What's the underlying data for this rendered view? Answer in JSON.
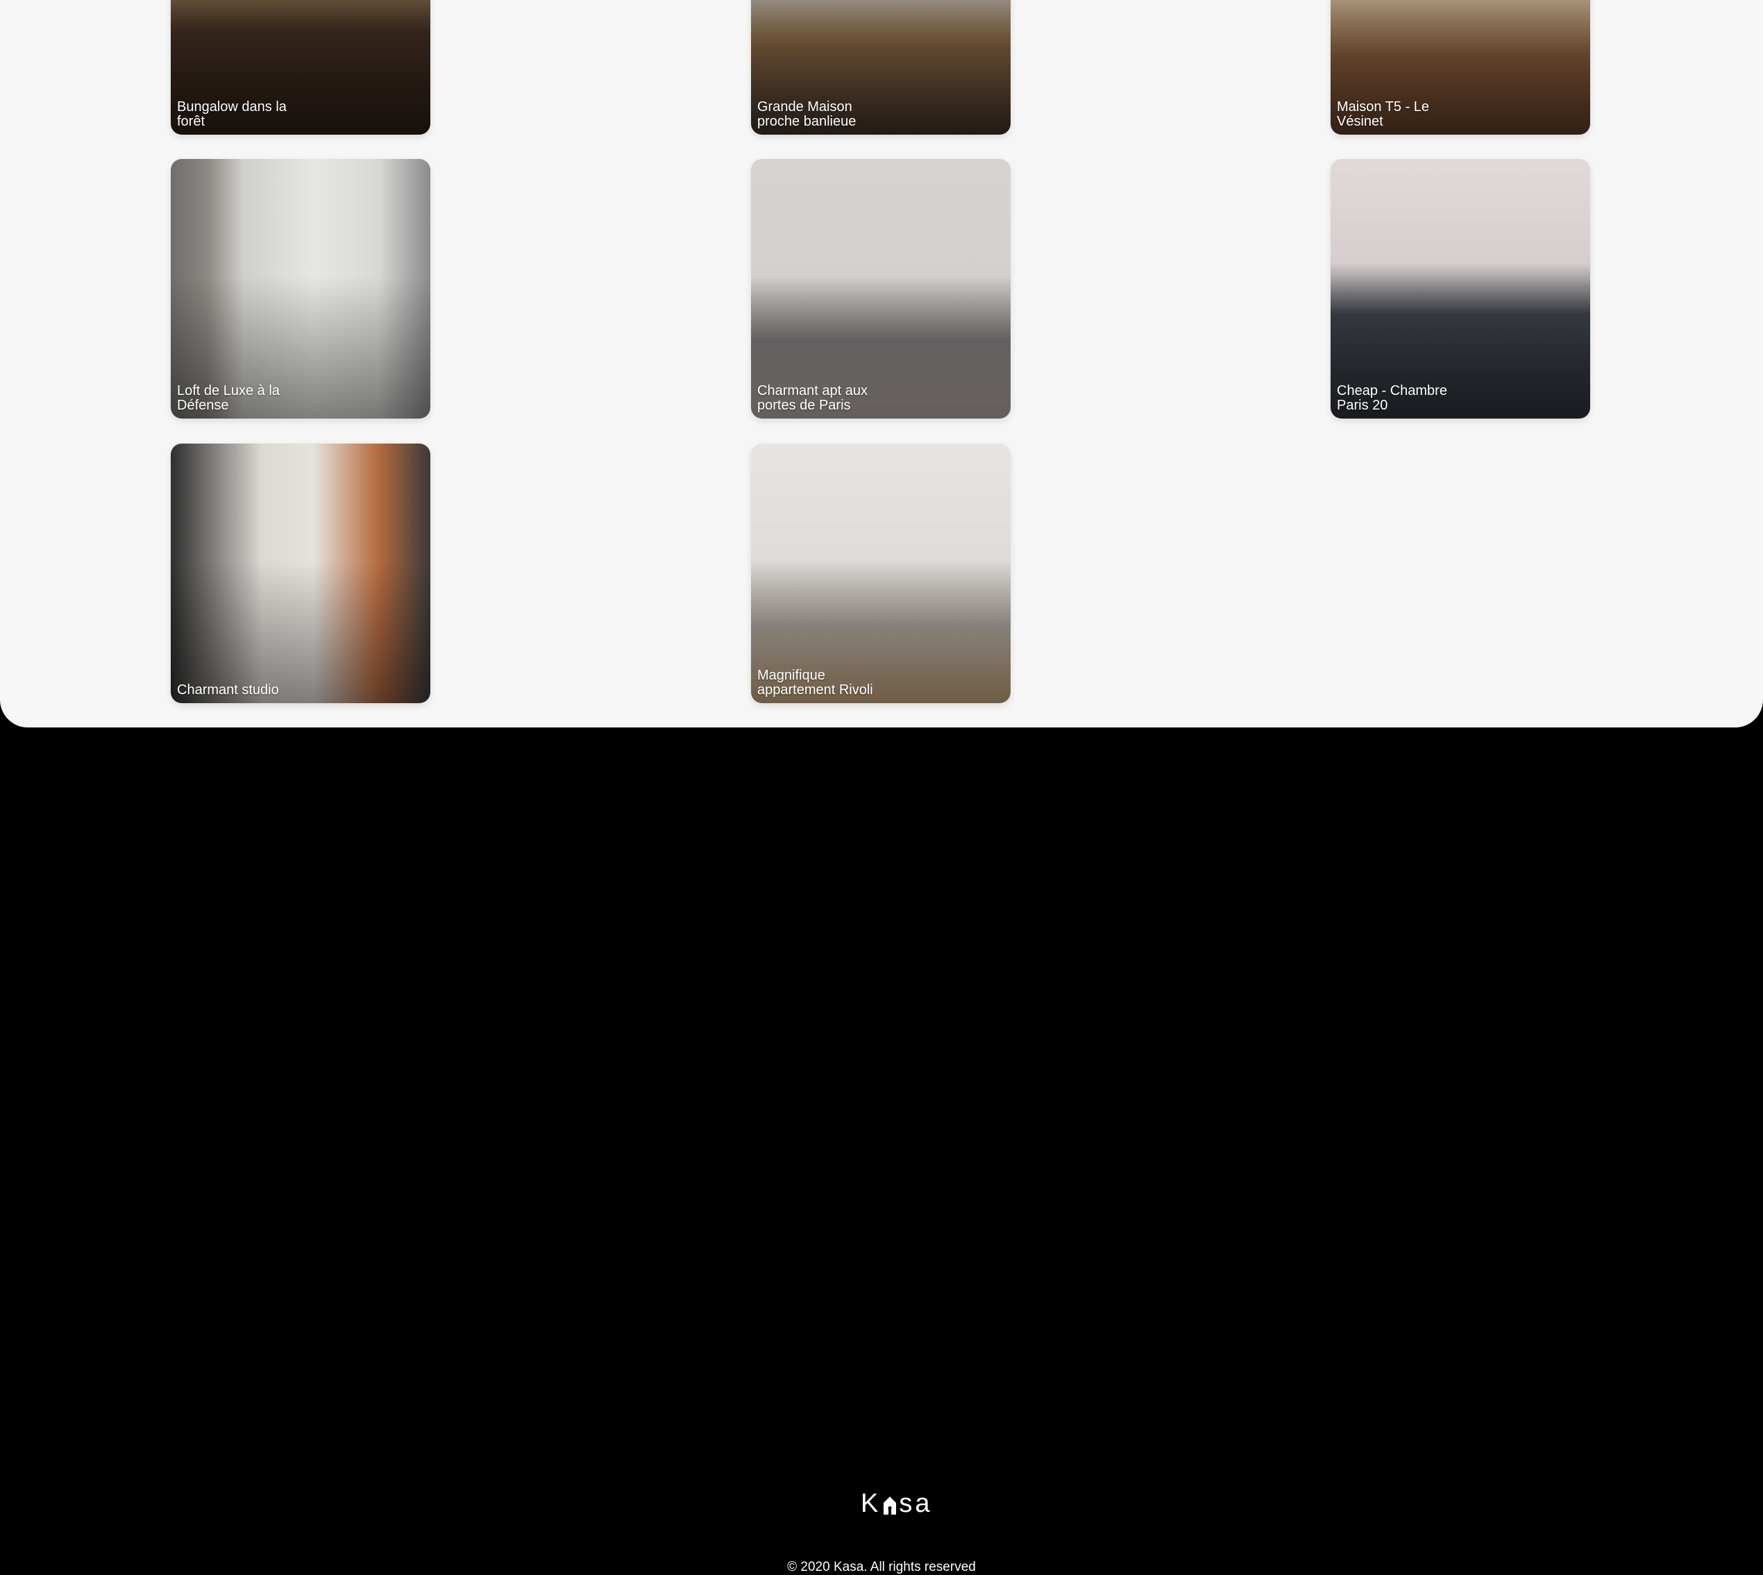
{
  "listings": [
    {
      "title": "Bungalow dans la forêt"
    },
    {
      "title": "Grande Maison proche banlieue"
    },
    {
      "title": "Maison T5 - Le Vésinet"
    },
    {
      "title": "Loft de Luxe à la Défense"
    },
    {
      "title": "Charmant apt aux portes de Paris"
    },
    {
      "title": "Cheap - Chambre Paris 20"
    },
    {
      "title": "Charmant studio"
    },
    {
      "title": "Magnifique appartement Rivoli"
    }
  ],
  "footer": {
    "logo_left": "K",
    "logo_right": "sa",
    "logo_icon": "house-icon",
    "copyright": "© 2020 Kasa. All rights reserved"
  }
}
